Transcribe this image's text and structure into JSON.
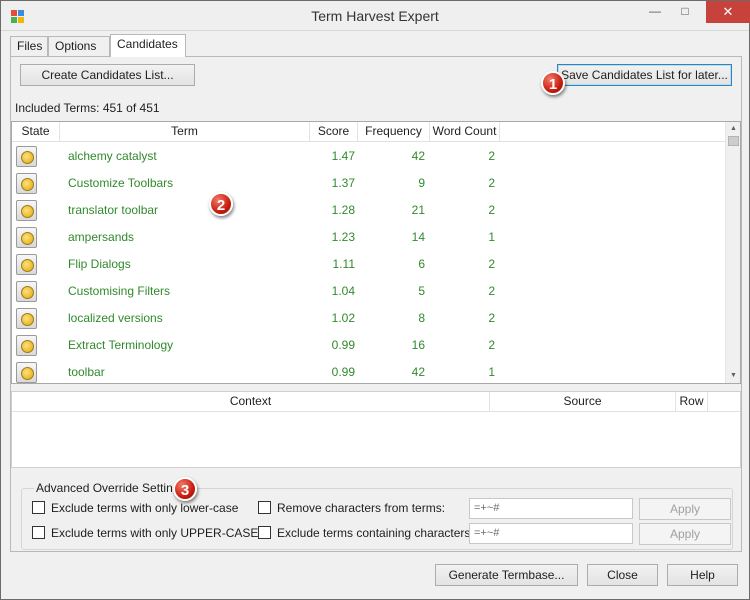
{
  "window": {
    "title": "Term Harvest Expert",
    "minimize": "—",
    "maximize": "□",
    "close": "✕"
  },
  "tabs": [
    {
      "label": "Files"
    },
    {
      "label": "Options"
    },
    {
      "label": "Candidates",
      "active": true
    }
  ],
  "candidates": {
    "create_button": "Create Candidates List...",
    "save_button": "Save Candidates List for later...",
    "included_terms": "Included Terms: 451 of 451"
  },
  "grid": {
    "columns": [
      "State",
      "Term",
      "Score",
      "Frequency",
      "Word Count"
    ],
    "rows": [
      {
        "term": "alchemy catalyst",
        "score": "1.47",
        "frequency": "42",
        "word_count": "2"
      },
      {
        "term": "Customize Toolbars",
        "score": "1.37",
        "frequency": "9",
        "word_count": "2"
      },
      {
        "term": "translator toolbar",
        "score": "1.28",
        "frequency": "21",
        "word_count": "2"
      },
      {
        "term": "ampersands",
        "score": "1.23",
        "frequency": "14",
        "word_count": "1"
      },
      {
        "term": "Flip Dialogs",
        "score": "1.11",
        "frequency": "6",
        "word_count": "2"
      },
      {
        "term": "Customising Filters",
        "score": "1.04",
        "frequency": "5",
        "word_count": "2"
      },
      {
        "term": "localized versions",
        "score": "1.02",
        "frequency": "8",
        "word_count": "2"
      },
      {
        "term": "Extract Terminology",
        "score": "0.99",
        "frequency": "16",
        "word_count": "2"
      },
      {
        "term": "toolbar",
        "score": "0.99",
        "frequency": "42",
        "word_count": "1"
      }
    ],
    "term_color": "#318a2c"
  },
  "context_grid": {
    "columns": [
      "Context",
      "Source",
      "Row"
    ]
  },
  "advanced": {
    "title": "Advanced Override Settings",
    "exclude_lower": "Exclude terms with only lower-case",
    "exclude_upper": "Exclude terms with only UPPER-CASE",
    "remove_chars": "Remove characters from terms:",
    "exclude_chars": "Exclude terms containing characters:",
    "remove_value": "=+~#",
    "exclude_value": "=+~#",
    "apply_label": "Apply"
  },
  "footer": {
    "generate": "Generate Termbase...",
    "close": "Close",
    "help": "Help"
  },
  "callouts": [
    "1",
    "2",
    "3"
  ],
  "colors": {
    "callout": "#c81e0e",
    "close_button": "#c7423b"
  }
}
